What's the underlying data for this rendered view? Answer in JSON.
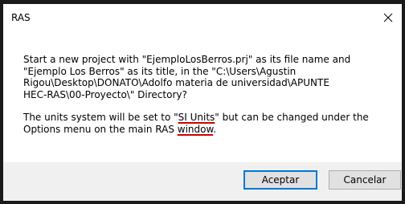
{
  "window": {
    "title": "RAS",
    "close_icon": "close-icon"
  },
  "message": {
    "lines_p1": [
      "Start a new project with \"EjemploLosBerros.prj\" as its file name and",
      "\"Ejemplo Los Berros\" as its title, in the \"C:\\Users\\Agustin",
      "Rigou\\Desktop\\DONATO\\Adolfo materia de universidad\\APUNTE",
      "HEC-RAS\\00-Proyecto\\\" Directory?"
    ],
    "p2_line1_before": "The units system will be set to \"",
    "p2_line1_units": "SI Units",
    "p2_line1_after": "\" but can be changed under the",
    "p2_line2_before": "Options menu on the main RAS ",
    "p2_line2_window": "window",
    "p2_line2_after": "."
  },
  "buttons": {
    "ok_label": "Aceptar",
    "cancel_label": "Cancelar"
  },
  "colors": {
    "annotation_underline": "#d00000",
    "default_button_border": "#0078d7",
    "button_bar_bg": "#f0f0f0"
  }
}
